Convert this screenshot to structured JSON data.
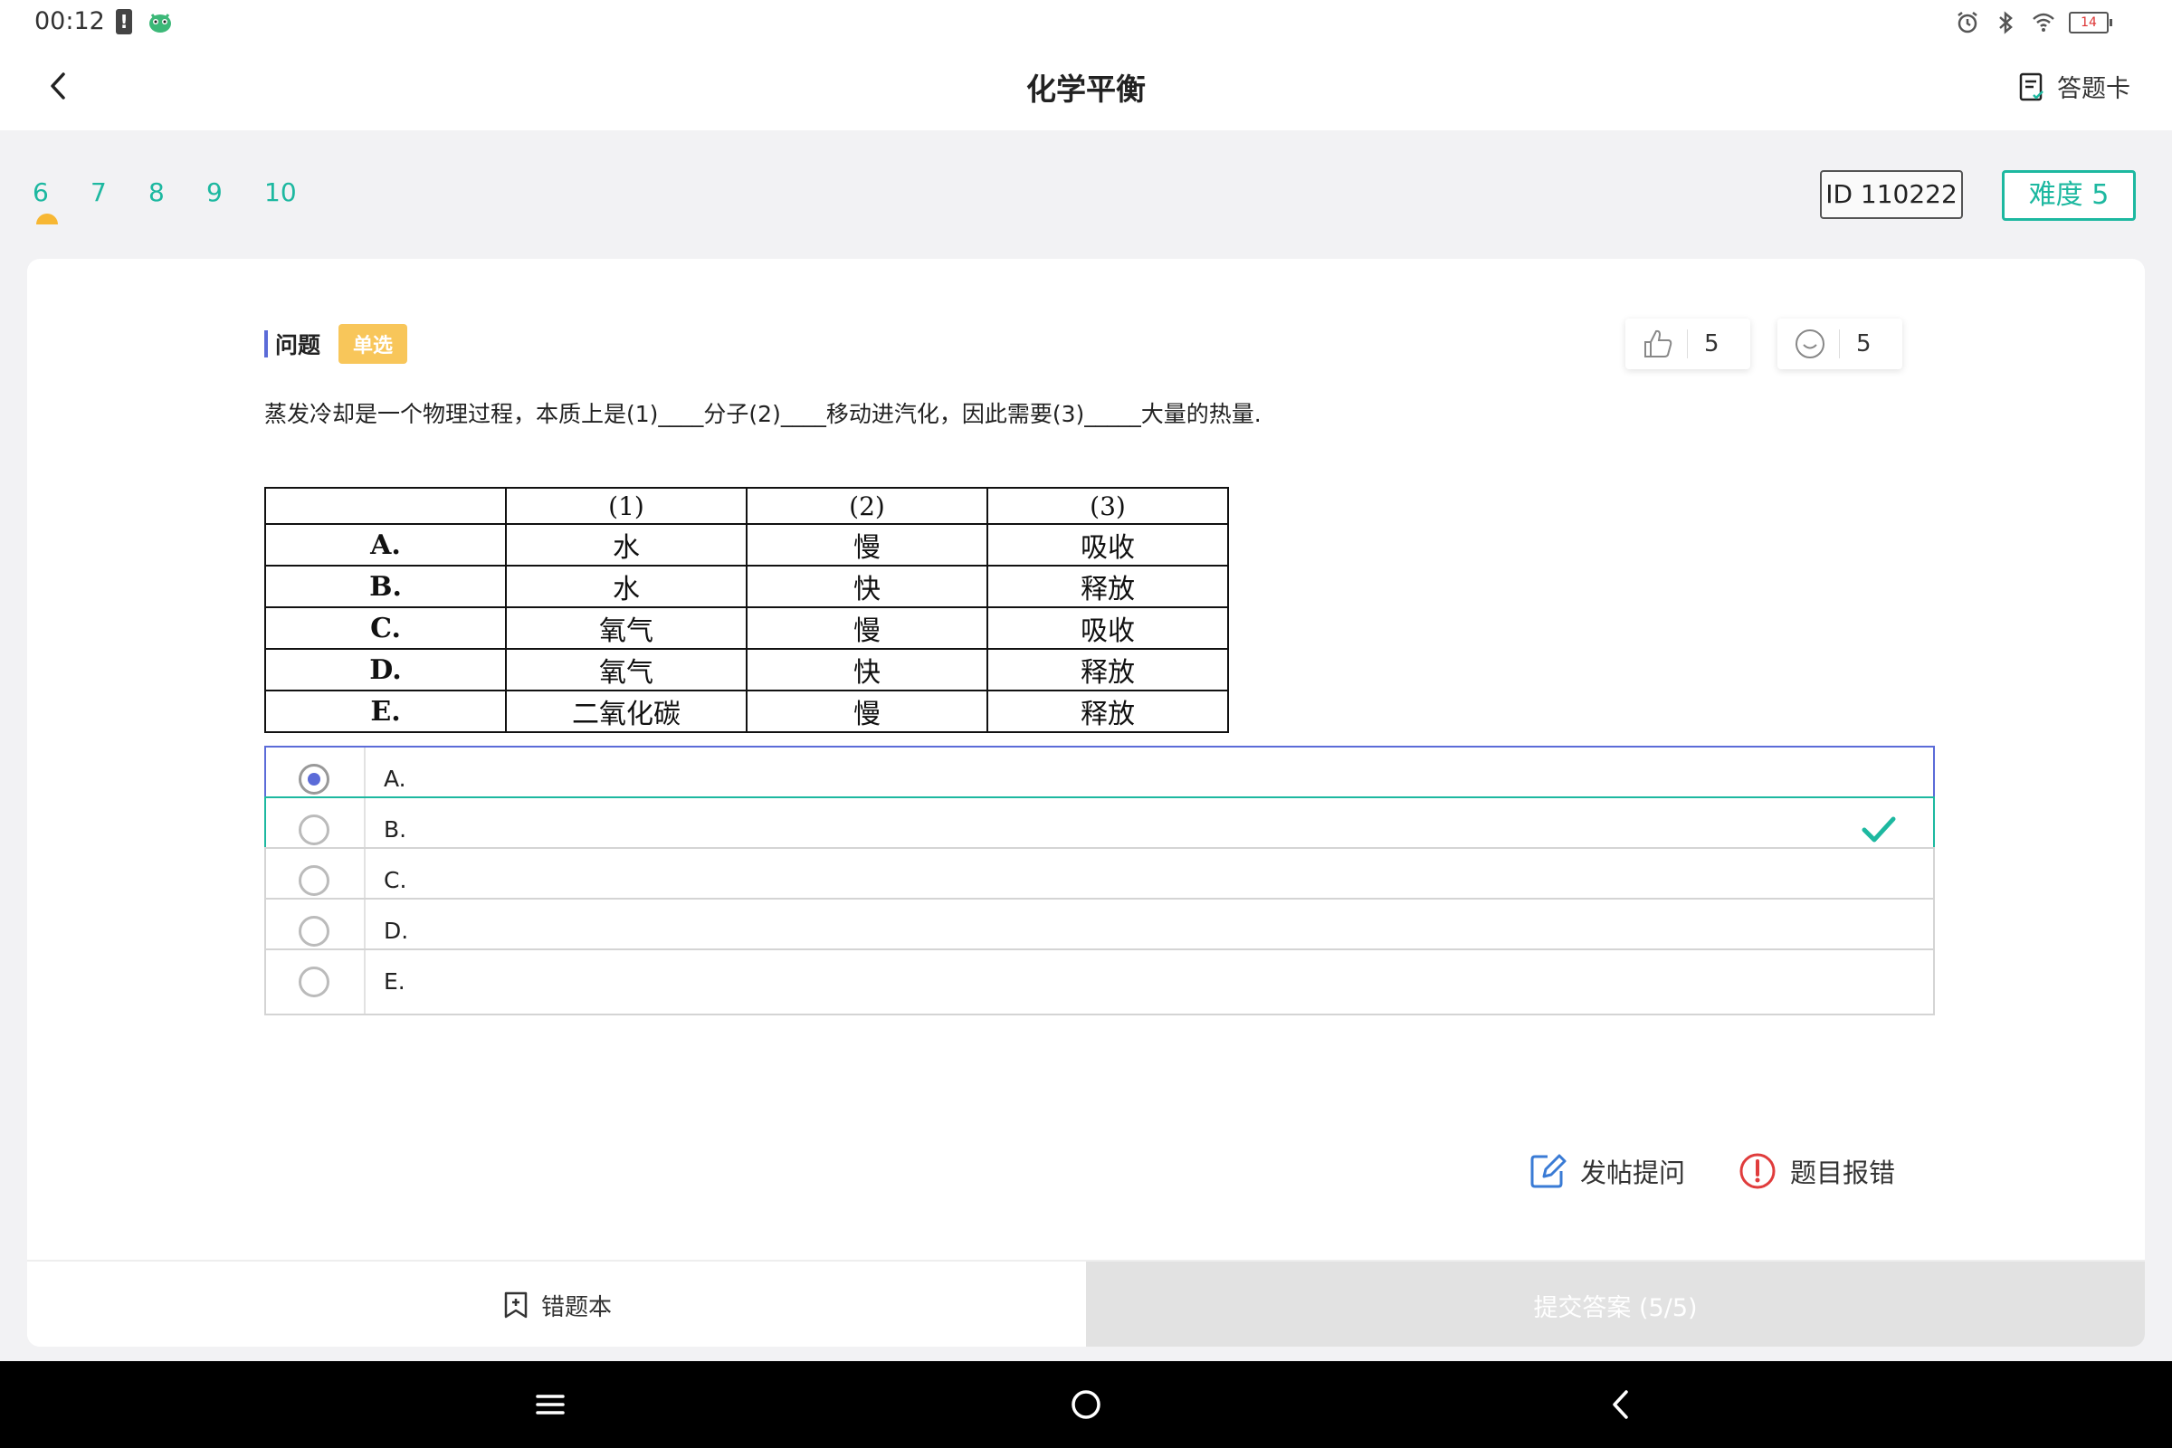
{
  "status_bar": {
    "time": "00:12",
    "battery_level": "14",
    "icons": [
      "battery-alert-icon",
      "app-icon",
      "alarm-icon",
      "bluetooth-icon",
      "wifi-icon",
      "battery-icon"
    ]
  },
  "header": {
    "title": "化学平衡",
    "answer_card_label": "答题卡"
  },
  "question_tabs": [
    "6",
    "7",
    "8",
    "9",
    "10"
  ],
  "active_tab": "6",
  "id_badge": "ID 110222",
  "difficulty_badge": "难度 5",
  "question": {
    "label": "问题",
    "type": "单选",
    "likes": "5",
    "smiles": "5",
    "text": "蒸发冷却是一个物理过程，本质上是(1)____分子(2)____移动进汽化，因此需要(3)_____大量的热量."
  },
  "table": {
    "headers": [
      "",
      "(1)",
      "(2)",
      "(3)"
    ],
    "rows": [
      [
        "A.",
        "水",
        "慢",
        "吸收"
      ],
      [
        "B.",
        "水",
        "快",
        "释放"
      ],
      [
        "C.",
        "氧气",
        "慢",
        "吸收"
      ],
      [
        "D.",
        "氧气",
        "快",
        "释放"
      ],
      [
        "E.",
        "二氧化碳",
        "慢",
        "释放"
      ]
    ]
  },
  "options": [
    {
      "label": "A.",
      "state": "selected"
    },
    {
      "label": "B.",
      "state": "correct"
    },
    {
      "label": "C.",
      "state": "none"
    },
    {
      "label": "D.",
      "state": "none"
    },
    {
      "label": "E.",
      "state": "none"
    }
  ],
  "actions": {
    "post_question": "发帖提问",
    "report_error": "题目报错"
  },
  "bottom": {
    "mistake_book": "错题本",
    "submit": "提交答案 (5/5)"
  },
  "colors": {
    "accent_teal": "#1db8a0",
    "selected_blue": "#5b6bd8",
    "badge_yellow": "#f8c65a",
    "error_red": "#e03c3c"
  }
}
